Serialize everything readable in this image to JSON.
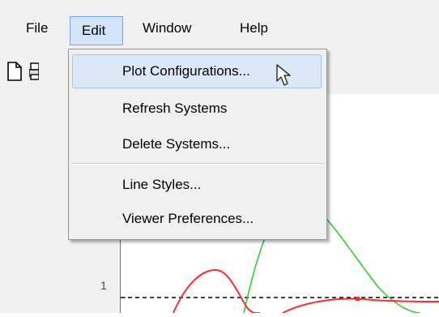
{
  "menubar": {
    "file": "File",
    "edit": "Edit",
    "window": "Window",
    "help": "Help"
  },
  "toolbar": {
    "icons": [
      "new-document-icon",
      "print-icon"
    ]
  },
  "edit_menu": {
    "items": [
      {
        "label": "Plot Configurations...",
        "hovered": true
      },
      {
        "label": "Refresh Systems"
      },
      {
        "label": "Delete Systems..."
      },
      {
        "label": "Line Styles..."
      },
      {
        "label": "Viewer Preferences..."
      }
    ]
  },
  "plot": {
    "y_tick_label": "1",
    "colors": {
      "red": "#ff2a2a",
      "green": "#2fcf2f",
      "axis": "#6f6f6f"
    }
  },
  "colors": {
    "menu_bg": "#f0f0f0",
    "active_menu_bg": "#d2e4f8",
    "active_menu_border": "#7aa3d8",
    "hover_item_bg": "#dbe8f8"
  }
}
